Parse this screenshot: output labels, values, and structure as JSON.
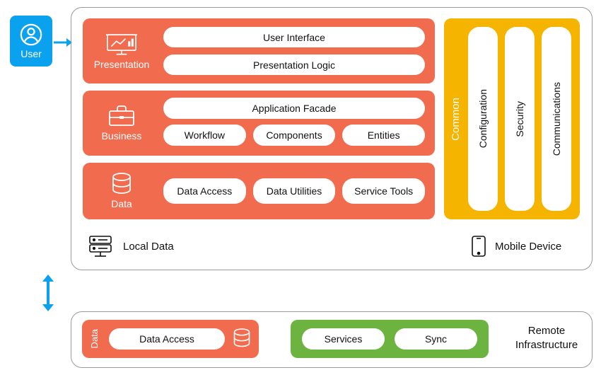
{
  "user": {
    "label": "User"
  },
  "arrows": {
    "color_blue": "#0aa1ef"
  },
  "top_container": {
    "local_data_label": "Local Data",
    "mobile_device_label": "Mobile Device"
  },
  "layers": {
    "presentation": {
      "title": "Presentation",
      "items": [
        "User Interface",
        "Presentation Logic"
      ]
    },
    "business": {
      "title": "Business",
      "top": "Application Facade",
      "items": [
        "Workflow",
        "Components",
        "Entities"
      ]
    },
    "data": {
      "title": "Data",
      "items": [
        "Data Access",
        "Data Utilities",
        "Service Tools"
      ]
    }
  },
  "cross_cutting": {
    "group_label": "Common",
    "items": [
      "Configuration",
      "Security",
      "Communications"
    ]
  },
  "remote": {
    "title": "Remote Infrastructure",
    "data_label": "Data",
    "data_item": "Data Access",
    "services_items": [
      "Services",
      "Sync"
    ]
  },
  "colors": {
    "orange": "#f16c4f",
    "yellow": "#f4b400",
    "green": "#6cb33f",
    "blue": "#0aa1ef"
  }
}
